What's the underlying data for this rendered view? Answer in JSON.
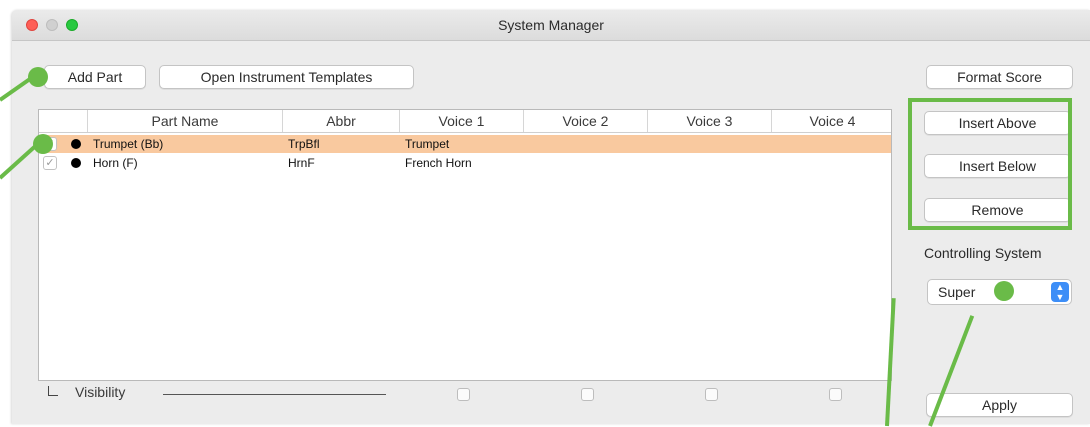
{
  "window": {
    "title": "System Manager"
  },
  "toolbar": {
    "add_part": "Add Part",
    "open_templates": "Open Instrument Templates",
    "format_score": "Format Score"
  },
  "table": {
    "columns": [
      "Part Name",
      "Abbr",
      "Voice 1",
      "Voice 2",
      "Voice 3",
      "Voice 4"
    ],
    "rows": [
      {
        "check": "✓",
        "name": "Trumpet (Bb)",
        "abbr": "TrpBfl",
        "voice1": "Trumpet",
        "selected": true
      },
      {
        "check": "✓",
        "name": "Horn (F)",
        "abbr": "HrnF",
        "voice1": "French Horn",
        "selected": false
      }
    ]
  },
  "visibility": {
    "label": "Visibility"
  },
  "side": {
    "insert_above": "Insert Above",
    "insert_below": "Insert Below",
    "remove": "Remove",
    "controlling_label": "Controlling System",
    "controlling_value": "Super",
    "apply": "Apply"
  },
  "colors": {
    "selection": "#f9c99f",
    "annotation": "#6abb48",
    "accent": "#3d8ef7"
  }
}
